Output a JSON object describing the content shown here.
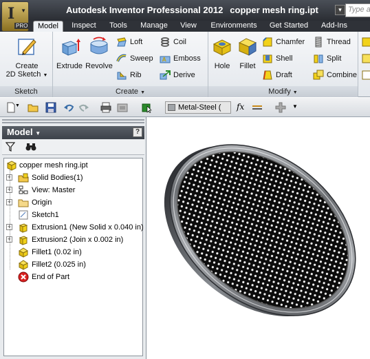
{
  "app": {
    "name": "Autodesk Inventor Professional 2012",
    "file": "copper mesh ring.ipt",
    "badge": "PRO",
    "search_placeholder": "Type a"
  },
  "tabs": [
    {
      "label": "Model",
      "active": true
    },
    {
      "label": "Inspect"
    },
    {
      "label": "Tools"
    },
    {
      "label": "Manage"
    },
    {
      "label": "View"
    },
    {
      "label": "Environments"
    },
    {
      "label": "Get Started"
    },
    {
      "label": "Add-Ins"
    }
  ],
  "ribbon": {
    "sketch": {
      "title": "Sketch",
      "create_sketch_line1": "Create",
      "create_sketch_line2": "2D Sketch"
    },
    "create": {
      "title": "Create",
      "extrude": "Extrude",
      "revolve": "Revolve",
      "loft": "Loft",
      "sweep": "Sweep",
      "rib": "Rib",
      "coil": "Coil",
      "emboss": "Emboss",
      "derive": "Derive"
    },
    "modify": {
      "title": "Modify",
      "hole": "Hole",
      "fillet": "Fillet",
      "chamfer": "Chamfer",
      "shell": "Shell",
      "draft": "Draft",
      "thread": "Thread",
      "split": "Split",
      "combine": "Combine"
    }
  },
  "qat": {
    "material": "Metal-Steel (",
    "function_symbol": "fx"
  },
  "browser": {
    "title": "Model",
    "help": "?",
    "items": [
      {
        "label": "copper mesh ring.ipt",
        "icon": "part-icon",
        "expander": ""
      },
      {
        "label": "Solid Bodies(1)",
        "icon": "solid-bodies-icon",
        "expander": "+"
      },
      {
        "label": "View: Master",
        "icon": "view-icon",
        "expander": "+"
      },
      {
        "label": "Origin",
        "icon": "folder-icon",
        "expander": "+"
      },
      {
        "label": "Sketch1",
        "icon": "sketch-icon",
        "expander": ""
      },
      {
        "label": "Extrusion1 (New Solid x 0.040 in)",
        "icon": "extrusion-icon",
        "expander": "+"
      },
      {
        "label": "Extrusion2 (Join x 0.002 in)",
        "icon": "extrusion-icon",
        "expander": "+"
      },
      {
        "label": "Fillet1 (0.02 in)",
        "icon": "fillet-icon",
        "expander": ""
      },
      {
        "label": "Fillet2 (0.025 in)",
        "icon": "fillet-icon",
        "expander": ""
      },
      {
        "label": "End of Part",
        "icon": "end-of-part-icon",
        "expander": ""
      }
    ]
  },
  "colors": {
    "titlebar": "#2a2d33",
    "ribbon": "#e8ebef",
    "part_yellow": "#f2d21a",
    "ring_metal": "#8a8e93"
  }
}
